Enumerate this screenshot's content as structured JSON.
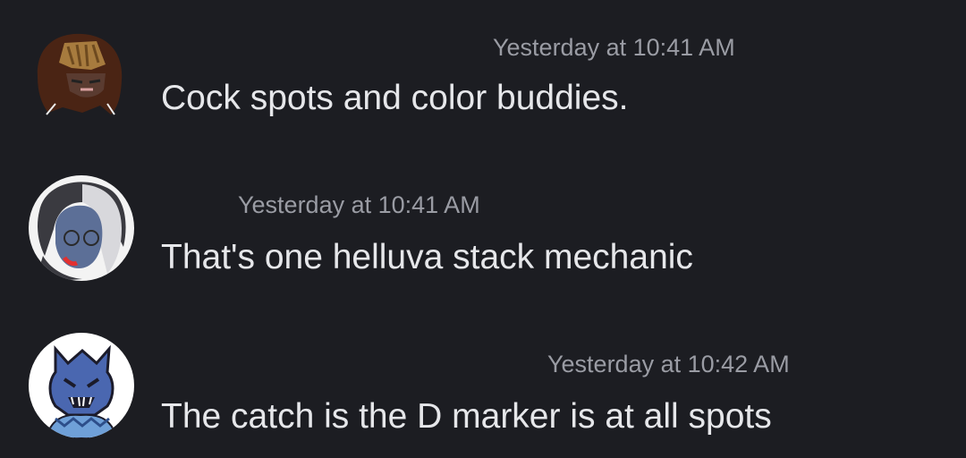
{
  "messages": [
    {
      "avatar_icon": "user-avatar-brown-hair-icon",
      "timestamp": "Yesterday at 10:41 AM",
      "text": "Cock spots and color buddies."
    },
    {
      "avatar_icon": "user-avatar-silver-hair-icon",
      "timestamp": "Yesterday at 10:41 AM",
      "text": "That's one helluva stack mechanic"
    },
    {
      "avatar_icon": "user-avatar-blue-dragon-icon",
      "timestamp": "Yesterday at 10:42 AM",
      "text": "The catch is the D marker is at all spots"
    }
  ],
  "colors": {
    "background": "#1c1d22",
    "timestamp": "#9a9ca4",
    "message_text": "#e6e7ea"
  }
}
